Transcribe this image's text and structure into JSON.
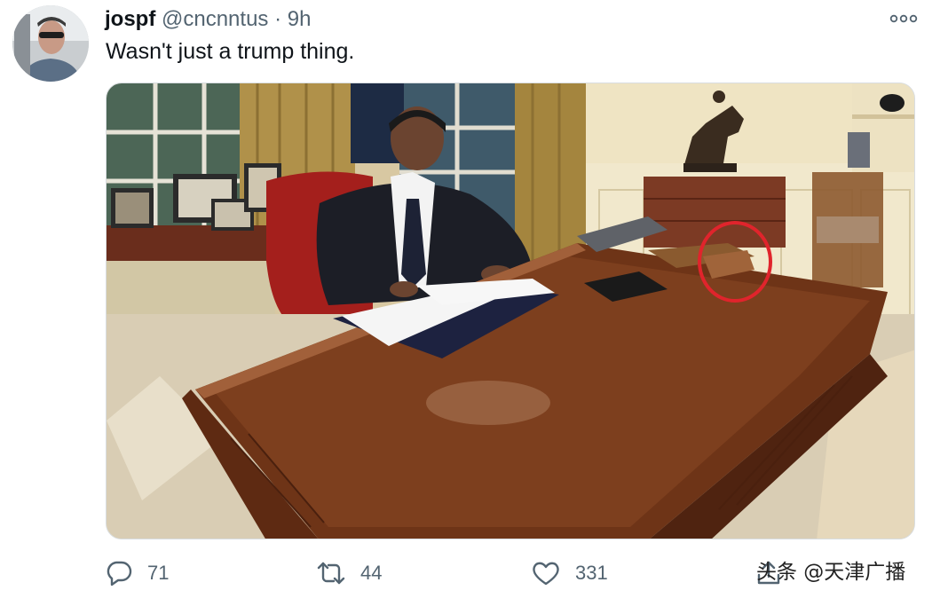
{
  "tweet": {
    "display_name": "jospf",
    "handle": "@cncnntus",
    "separator": "·",
    "time": "9h",
    "text": "Wasn't just a trump thing.",
    "more_icon": "more-horizontal-icon",
    "media": {
      "description_icon": "photo",
      "highlight_color": "#e0242c"
    },
    "actions": {
      "reply": {
        "icon": "reply-icon",
        "count": "71"
      },
      "retweet": {
        "icon": "retweet-icon",
        "count": "44"
      },
      "like": {
        "icon": "heart-icon",
        "count": "331"
      },
      "share": {
        "icon": "share-icon"
      }
    }
  },
  "watermark": "头条 @天津广播",
  "colors": {
    "text": "#0f1419",
    "secondary": "#536471",
    "background": "#ffffff"
  }
}
